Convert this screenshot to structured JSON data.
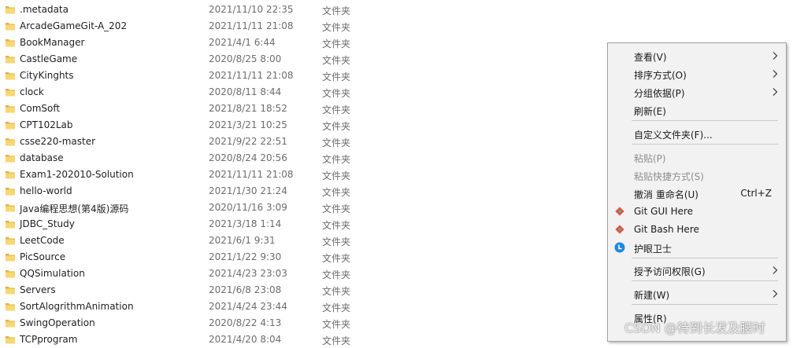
{
  "files": [
    {
      "name": ".metadata",
      "date": "2021/11/10 22:35",
      "type": "文件夹"
    },
    {
      "name": "ArcadeGameGit-A_202",
      "date": "2021/11/11 21:08",
      "type": "文件夹"
    },
    {
      "name": "BookManager",
      "date": "2021/4/1 6:44",
      "type": "文件夹"
    },
    {
      "name": "CastleGame",
      "date": "2020/8/25 8:00",
      "type": "文件夹"
    },
    {
      "name": "CityKinghts",
      "date": "2021/11/11 21:08",
      "type": "文件夹"
    },
    {
      "name": "clock",
      "date": "2020/8/11 8:44",
      "type": "文件夹"
    },
    {
      "name": "ComSoft",
      "date": "2021/8/21 18:52",
      "type": "文件夹"
    },
    {
      "name": "CPT102Lab",
      "date": "2021/3/21 10:25",
      "type": "文件夹"
    },
    {
      "name": "csse220-master",
      "date": "2021/9/22 22:51",
      "type": "文件夹"
    },
    {
      "name": "database",
      "date": "2020/8/24 20:56",
      "type": "文件夹"
    },
    {
      "name": "Exam1-202010-Solution",
      "date": "2021/11/11 21:08",
      "type": "文件夹"
    },
    {
      "name": "hello-world",
      "date": "2021/1/30 21:24",
      "type": "文件夹"
    },
    {
      "name": "Java编程思想(第4版)源码",
      "date": "2020/11/16 3:09",
      "type": "文件夹"
    },
    {
      "name": "JDBC_Study",
      "date": "2021/3/18 1:14",
      "type": "文件夹"
    },
    {
      "name": "LeetCode",
      "date": "2021/6/1 9:31",
      "type": "文件夹"
    },
    {
      "name": "PicSource",
      "date": "2021/1/22 9:30",
      "type": "文件夹"
    },
    {
      "name": "QQSimulation",
      "date": "2021/4/23 23:03",
      "type": "文件夹"
    },
    {
      "name": "Servers",
      "date": "2021/6/8 23:08",
      "type": "文件夹"
    },
    {
      "name": "SortAlogrithmAnimation",
      "date": "2021/4/24 23:44",
      "type": "文件夹"
    },
    {
      "name": "SwingOperation",
      "date": "2020/8/22 4:13",
      "type": "文件夹"
    },
    {
      "name": "TCPprogram",
      "date": "2021/4/20 8:04",
      "type": "文件夹"
    }
  ],
  "context_menu": {
    "items": [
      {
        "label": "查看(V)",
        "submenu": true,
        "name": "menu-item-view"
      },
      {
        "label": "排序方式(O)",
        "submenu": true,
        "name": "menu-item-sort-by"
      },
      {
        "label": "分组依据(P)",
        "submenu": true,
        "name": "menu-item-group-by"
      },
      {
        "label": "刷新(E)",
        "name": "menu-item-refresh"
      },
      {
        "separator": true
      },
      {
        "label": "自定义文件夹(F)...",
        "name": "menu-item-customize-folder"
      },
      {
        "separator": true
      },
      {
        "label": "粘贴(P)",
        "disabled": true,
        "name": "menu-item-paste"
      },
      {
        "label": "粘贴快捷方式(S)",
        "disabled": true,
        "name": "menu-item-paste-shortcut"
      },
      {
        "label": "撤消 重命名(U)",
        "shortcut": "Ctrl+Z",
        "name": "menu-item-undo-rename"
      },
      {
        "label": "Git GUI Here",
        "icon": "git-icon",
        "name": "menu-item-git-gui"
      },
      {
        "label": "Git Bash Here",
        "icon": "git-icon",
        "name": "menu-item-git-bash"
      },
      {
        "label": "护眼卫士",
        "icon": "eye-guard-icon",
        "name": "menu-item-eye-guard"
      },
      {
        "separator": true
      },
      {
        "label": "授予访问权限(G)",
        "submenu": true,
        "name": "menu-item-grant-access"
      },
      {
        "separator": true
      },
      {
        "label": "新建(W)",
        "submenu": true,
        "name": "menu-item-new"
      },
      {
        "separator": true
      },
      {
        "label": "属性(R)",
        "name": "menu-item-properties"
      }
    ]
  },
  "watermark": "CSDN @待到长发及腰时",
  "colors": {
    "folder": "#f8d775",
    "folder_dark": "#e0b342",
    "menu_bg": "#f2f2f2",
    "disabled_text": "#8f8f8f",
    "eye_guard_blue": "#1e88e5"
  }
}
